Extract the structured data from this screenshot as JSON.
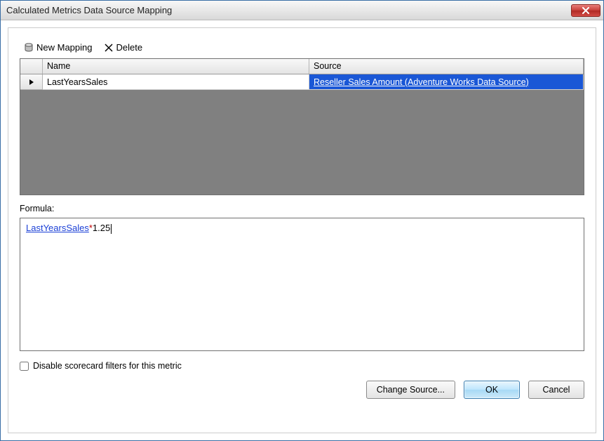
{
  "window": {
    "title": "Calculated Metrics Data Source Mapping"
  },
  "toolbar": {
    "new_mapping_label": "New Mapping",
    "delete_label": "Delete"
  },
  "grid": {
    "columns": {
      "name": "Name",
      "source": "Source"
    },
    "rows": [
      {
        "name": "LastYearsSales",
        "source": "Reseller Sales Amount (Adventure Works Data Source)",
        "source_selected": true
      }
    ]
  },
  "formula": {
    "label": "Formula:",
    "variable": "LastYearsSales",
    "operator": "*",
    "literal": "1.25"
  },
  "checkbox": {
    "label": "Disable scorecard filters for this metric",
    "checked": false
  },
  "buttons": {
    "change_source": "Change Source...",
    "ok": "OK",
    "cancel": "Cancel"
  }
}
